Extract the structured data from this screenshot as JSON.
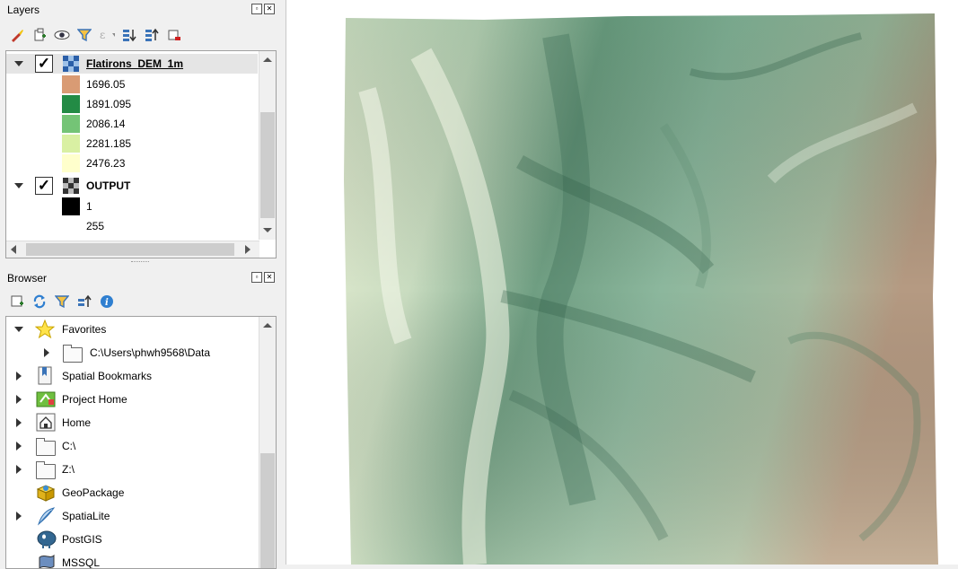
{
  "layers_panel": {
    "title": "Layers",
    "layers": [
      {
        "name": "Flatirons_DEM_1m",
        "checked": true,
        "legend": [
          {
            "label": "1696.05",
            "color": "#d99b74"
          },
          {
            "label": "1891.095",
            "color": "#238b45"
          },
          {
            "label": "2086.14",
            "color": "#74c476"
          },
          {
            "label": "2281.185",
            "color": "#d9f0a3"
          },
          {
            "label": "2476.23",
            "color": "#ffffcc"
          }
        ]
      },
      {
        "name": "OUTPUT",
        "checked": true,
        "legend": [
          {
            "label": "1",
            "color": "#000000"
          },
          {
            "label": "255",
            "color": "#ffffff"
          }
        ]
      }
    ]
  },
  "browser_panel": {
    "title": "Browser",
    "items": [
      {
        "label": "Favorites",
        "icon": "star-icon"
      },
      {
        "label": "C:\\Users\\phwh9568\\Data",
        "icon": "folder-icon"
      },
      {
        "label": "Spatial Bookmarks",
        "icon": "bookmark-icon"
      },
      {
        "label": "Project Home",
        "icon": "project-home-icon"
      },
      {
        "label": "Home",
        "icon": "home-icon"
      },
      {
        "label": "C:\\",
        "icon": "folder-icon"
      },
      {
        "label": "Z:\\",
        "icon": "folder-icon"
      },
      {
        "label": "GeoPackage",
        "icon": "geopackage-icon"
      },
      {
        "label": "SpatiaLite",
        "icon": "spatialite-icon"
      },
      {
        "label": "PostGIS",
        "icon": "postgis-icon"
      },
      {
        "label": "MSSQL",
        "icon": "mssql-icon"
      }
    ]
  }
}
